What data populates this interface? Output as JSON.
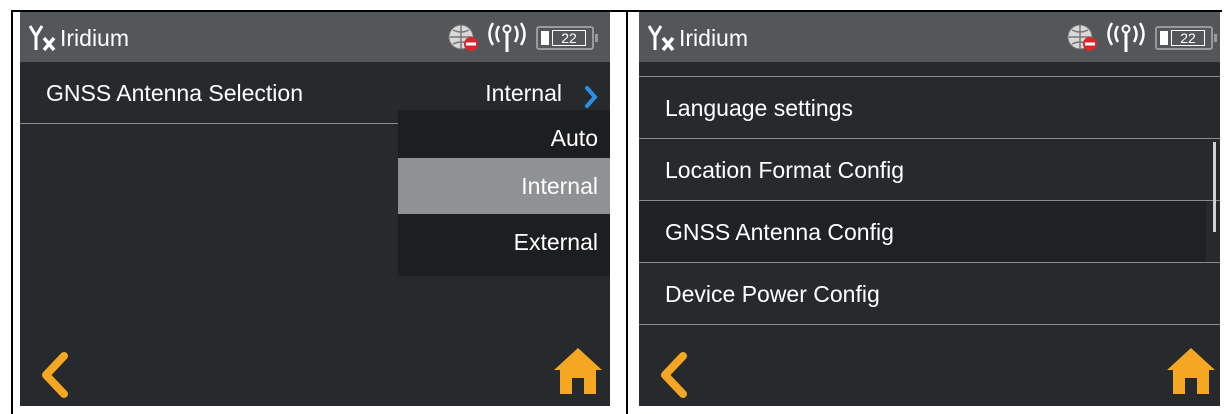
{
  "colors": {
    "accent": "#f5a623",
    "chevron_blue": "#2b8fe6",
    "statusbar": "#545759",
    "background": "#262a2d"
  },
  "left_screen": {
    "statusbar": {
      "title": "Iridium",
      "battery_level": "22",
      "icons": [
        "no-signal-antenna-icon",
        "globe-no-entry-icon",
        "satellite-signal-icon",
        "battery-icon"
      ]
    },
    "setting_row": {
      "label": "GNSS Antenna Selection",
      "value": "Internal",
      "chevron": "chevron-right-icon"
    },
    "dropdown": {
      "options": [
        "Auto",
        "Internal",
        "External"
      ],
      "selected": "Internal"
    },
    "footer": {
      "back": "back-chevron-icon",
      "home": "home-icon"
    }
  },
  "right_screen": {
    "statusbar": {
      "title": "Iridium",
      "battery_level": "22",
      "icons": [
        "no-signal-antenna-icon",
        "globe-no-entry-icon",
        "satellite-signal-icon",
        "battery-icon"
      ]
    },
    "menu": {
      "items": [
        "Language settings",
        "Location Format Config",
        "GNSS Antenna Config",
        "Device Power Config"
      ],
      "active": "GNSS Antenna Config"
    },
    "footer": {
      "back": "back-chevron-icon",
      "home": "home-icon"
    }
  }
}
